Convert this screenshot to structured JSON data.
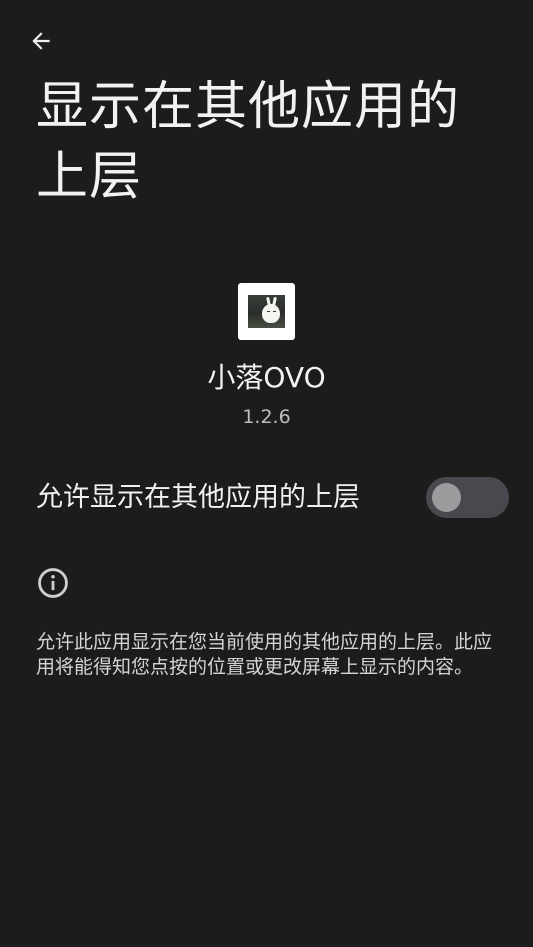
{
  "header": {
    "back_icon": "arrow-back-icon",
    "title": "显示在其他应用的上层"
  },
  "app": {
    "icon": "app-icon-bunny",
    "name": "小落OVO",
    "version": "1.2.6"
  },
  "permission": {
    "label": "允许显示在其他应用的上层",
    "enabled": false
  },
  "info": {
    "icon": "info-icon",
    "text": "允许此应用显示在您当前使用的其他应用的上层。此应用将能得知您点按的位置或更改屏幕上显示的内容。"
  },
  "colors": {
    "background": "#1c1c1c",
    "switch_track_off": "#48494e",
    "switch_thumb_off": "#9c9c9f"
  }
}
